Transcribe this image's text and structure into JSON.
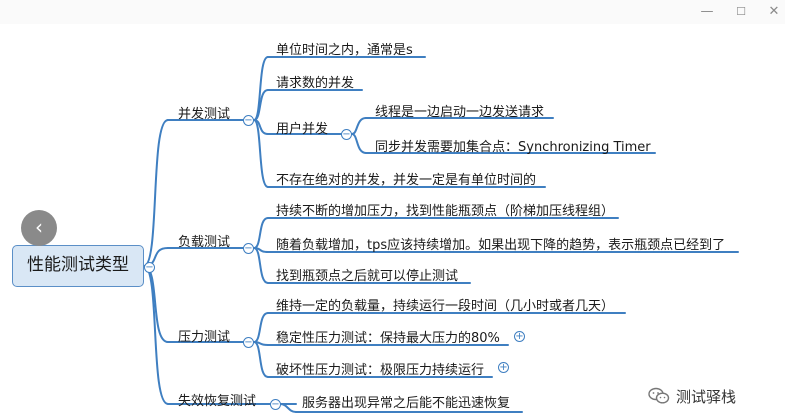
{
  "window": {
    "minimize_icon": "—",
    "maximize_icon": "☐",
    "close_icon": "✕"
  },
  "back_button": {
    "icon": "‹"
  },
  "mindmap": {
    "root": "性能测试类型",
    "branches": [
      {
        "label": "并发测试",
        "children": [
          {
            "label": "单位时间之内，通常是s"
          },
          {
            "label": "请求数的并发"
          },
          {
            "label": "用户并发",
            "children": [
              {
                "label": "线程是一边启动一边发送请求"
              },
              {
                "label": "同步并发需要加集合点：Synchronizing Timer"
              }
            ]
          },
          {
            "label": "不存在绝对的并发，并发一定是有单位时间的"
          }
        ]
      },
      {
        "label": "负载测试",
        "children": [
          {
            "label": "持续不断的增加压力，找到性能瓶颈点（阶梯加压线程组）"
          },
          {
            "label": "随着负载增加，tps应该持续增加。如果出现下降的趋势，表示瓶颈点已经到了"
          },
          {
            "label": "找到瓶颈点之后就可以停止测试"
          }
        ]
      },
      {
        "label": "压力测试",
        "children": [
          {
            "label": "维持一定的负载量，持续运行一段时间（几小时或者几天）"
          },
          {
            "label": "稳定性压力测试：保持最大压力的80%"
          },
          {
            "label": "破坏性压力测试：极限压力持续运行"
          }
        ]
      },
      {
        "label": "失效恢复测试",
        "children": [
          {
            "label": "服务器出现异常之后能不能迅速恢复"
          }
        ]
      }
    ]
  },
  "toggles": {
    "collapse": "−",
    "expand": "+"
  },
  "watermark": {
    "text": "测试驿栈",
    "icon": "wechat-icon"
  },
  "colors": {
    "line": "#3f7fc1",
    "root_fill": "#d9e7f5",
    "root_border": "#5b8fc7"
  }
}
